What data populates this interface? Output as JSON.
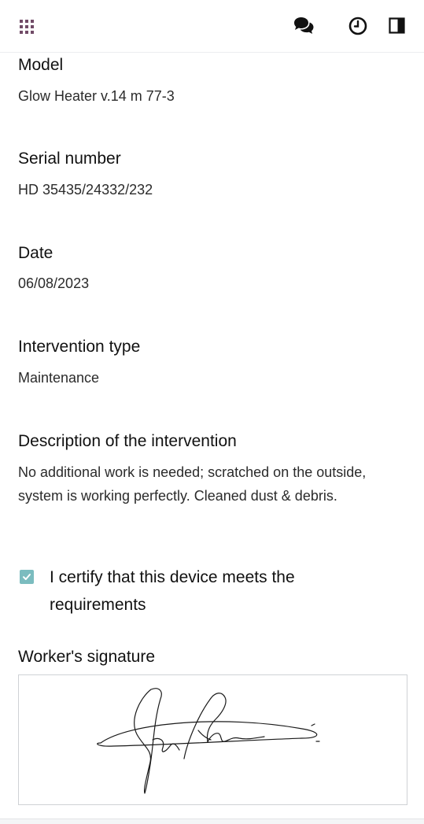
{
  "topbar": {
    "icons": [
      "apps-grid-icon",
      "chat-icon",
      "clock-icon",
      "side-panel-icon"
    ],
    "apps_color": "#714b67"
  },
  "fields": {
    "model": {
      "label": "Model",
      "value": "Glow Heater v.14 m 77-3"
    },
    "serial": {
      "label": "Serial number",
      "value": "HD 35435/24332/232"
    },
    "date": {
      "label": "Date",
      "value": "06/08/2023"
    },
    "intervention_type": {
      "label": "Intervention type",
      "value": "Maintenance"
    },
    "description": {
      "label": "Description of the intervention",
      "value": "No additional work is needed; scratched on the outside, system is working perfectly. Cleaned dust & debris."
    }
  },
  "certify": {
    "checked": true,
    "label": "I certify that this device meets the requirements",
    "checkbox_color": "#7bbcbf"
  },
  "signature": {
    "label": "Worker's signature"
  }
}
